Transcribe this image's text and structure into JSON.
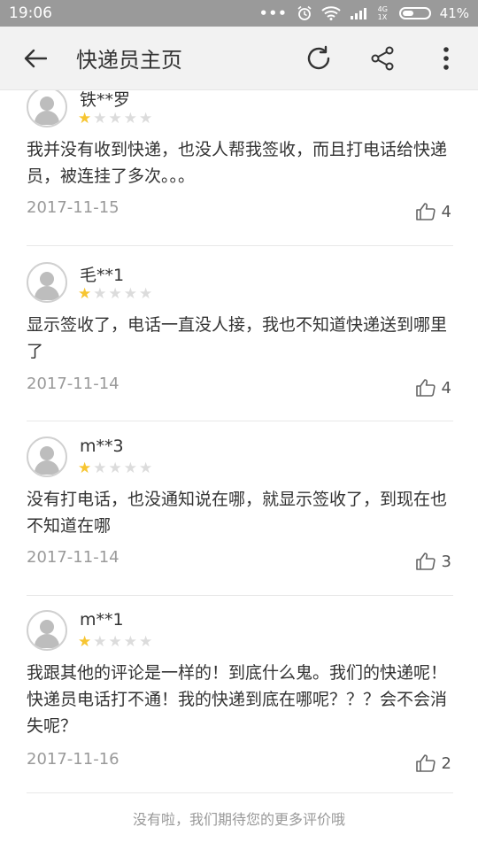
{
  "status_bar": {
    "time": "19:06",
    "signal_label": "4G 1X",
    "battery": "41%"
  },
  "app_bar": {
    "title": "快递员主页",
    "icons": [
      "back-arrow-icon",
      "refresh-icon",
      "share-icon",
      "more-vert-icon"
    ]
  },
  "reviews": [
    {
      "user": "铁**罗",
      "rating": 1,
      "text": "我并没有收到快递，也没人帮我签收，而且打电话给快递员，被连挂了多次。。。",
      "date": "2017-11-15",
      "likes": "4"
    },
    {
      "user": "毛**1",
      "rating": 1,
      "text": "显示签收了，电话一直没人接，我也不知道快递送到哪里了",
      "date": "2017-11-14",
      "likes": "4"
    },
    {
      "user": "m**3",
      "rating": 1,
      "text": "没有打电话，也没通知说在哪，就显示签收了，到现在也不知道在哪",
      "date": "2017-11-14",
      "likes": "3"
    },
    {
      "user": "m**1",
      "rating": 1,
      "text": "我跟其他的评论是一样的！到底什么鬼。我们的快递呢！快递员电话打不通！我的快递到底在哪呢？？？会不会消失呢？",
      "date": "2017-11-16",
      "likes": "2"
    }
  ],
  "footer_text": "没有啦，我们期待您的更多评价哦",
  "colors": {
    "status_bar": "#9a9a9a",
    "app_bar": "#f2f2f2",
    "star_on": "#f7c531",
    "star_off": "#dcdcdc",
    "date": "#9a9a9a"
  }
}
